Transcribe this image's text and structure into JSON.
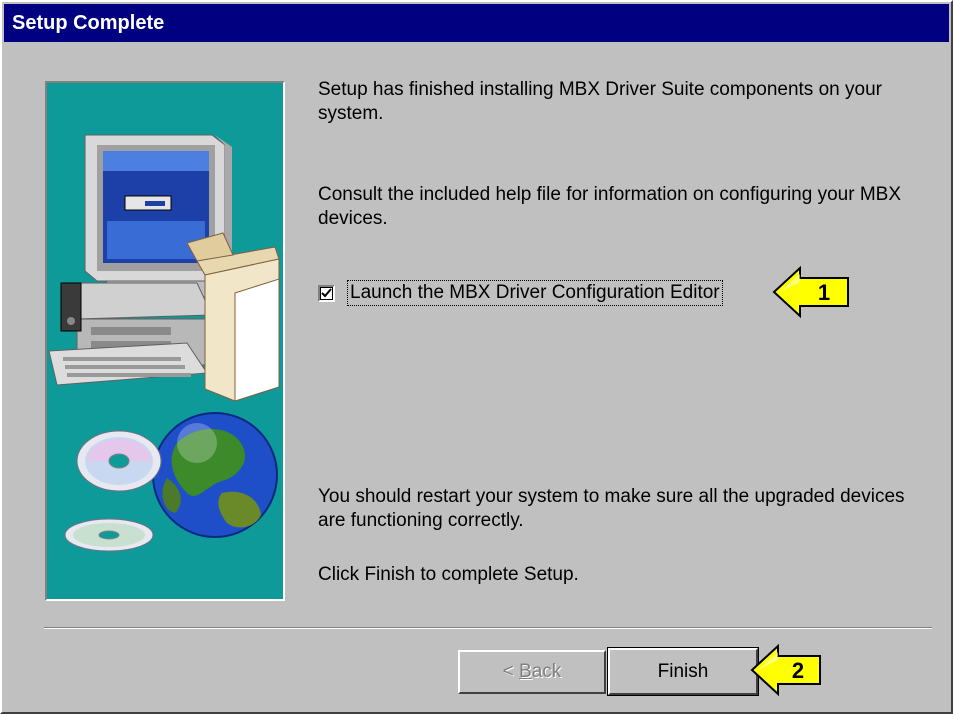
{
  "window": {
    "title": "Setup Complete"
  },
  "content": {
    "paragraph_1": "Setup has finished installing MBX Driver Suite components on your system.",
    "paragraph_2": "Consult the included help file for information on configuring your MBX devices.",
    "checkbox_label": "Launch the MBX Driver Configuration Editor",
    "checkbox_checked": true,
    "paragraph_3": "You should restart your system to make sure all the upgraded devices are functioning correctly.",
    "paragraph_4": "Click Finish to complete Setup."
  },
  "buttons": {
    "back_prefix": "< ",
    "back_mnemonic": "B",
    "back_rest": "ack",
    "finish": "Finish"
  },
  "callouts": {
    "one": "1",
    "two": "2"
  },
  "colors": {
    "titlebar": "#000080",
    "panel": "#0f9a9a",
    "callout": "#ffff00"
  },
  "icons": {
    "art": "computer-with-cds-and-globe-illustration",
    "check": "check-mark-icon",
    "arrow": "left-pointing-callout-arrow"
  }
}
